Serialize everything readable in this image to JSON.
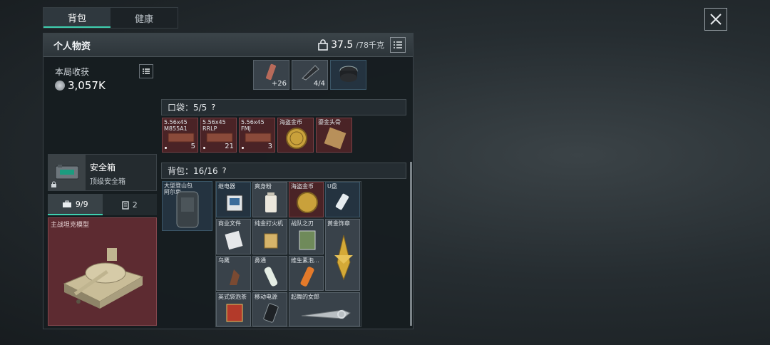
{
  "tabs": {
    "backpack": "背包",
    "health": "健康"
  },
  "header": {
    "title": "个人物资",
    "weight_current": "37.5",
    "weight_max": "/78千克"
  },
  "harvest": {
    "label": "本局收获",
    "value": "3,057K"
  },
  "safe_box": {
    "name": "安全箱",
    "subtitle": "顶级安全箱"
  },
  "subtabs": {
    "left": "9/9",
    "right": "2"
  },
  "big_slot": {
    "label": "主战坦克模型"
  },
  "top_items": [
    {
      "count": "+26"
    },
    {
      "count": "4/4"
    },
    {
      "count": ""
    }
  ],
  "pocket": {
    "title": "口袋：5/5",
    "help": "?",
    "items": [
      {
        "label": "5.56x45\nM855A1",
        "count": "5"
      },
      {
        "label": "5.56x45\nRRLP",
        "count": "21"
      },
      {
        "label": "5.56x45\nFMJ",
        "count": "3"
      },
      {
        "label": "海盗金币",
        "count": ""
      },
      {
        "label": "鎏金头骨",
        "count": ""
      }
    ]
  },
  "backpack": {
    "title": "背包：16/16",
    "help": "?",
    "bag_label": "大型登山包\n阿尔卑",
    "items": [
      {
        "label": "继电器"
      },
      {
        "label": "爽身粉"
      },
      {
        "label": "海盗金币"
      },
      {
        "label": "U盘"
      },
      {
        "label": "商业文件"
      },
      {
        "label": "纯金打火机"
      },
      {
        "label": "战队之刃"
      },
      {
        "label": "黄金饰章"
      },
      {
        "label": "乌鹰"
      },
      {
        "label": "鼻通"
      },
      {
        "label": "维生素泡..."
      },
      {
        "label": "英式袋泡茶"
      },
      {
        "label": "移动电源"
      },
      {
        "label": "起舞的女郎"
      }
    ]
  }
}
